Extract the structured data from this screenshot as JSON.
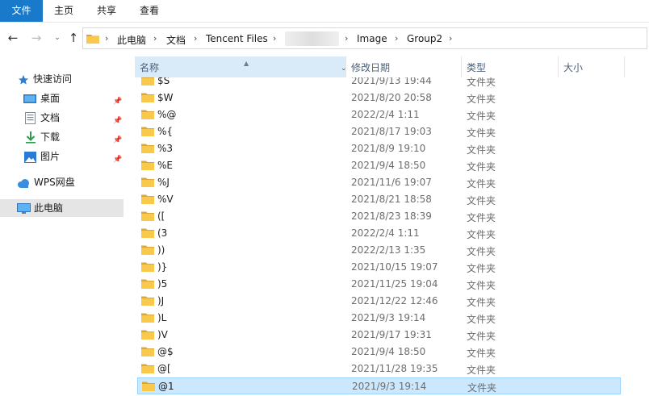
{
  "ribbon": {
    "file": "文件",
    "home": "主页",
    "share": "共享",
    "view": "查看"
  },
  "nav": {
    "back": "←",
    "forward": "→",
    "recent": "⌄",
    "up": "↑",
    "breadcrumb": [
      "此电脑",
      "文档",
      "Tencent Files",
      "Image",
      "Group2"
    ]
  },
  "sidebar": {
    "quick_access": "快速访问",
    "items": [
      {
        "label": "桌面",
        "icon": "desktop-icon"
      },
      {
        "label": "文档",
        "icon": "documents-icon"
      },
      {
        "label": "下载",
        "icon": "download-icon"
      },
      {
        "label": "图片",
        "icon": "pictures-icon"
      }
    ],
    "wps": "WPS网盘",
    "this_pc": "此电脑"
  },
  "columns": {
    "name": "名称",
    "date": "修改日期",
    "type": "类型",
    "size": "大小"
  },
  "files": [
    {
      "name": "$S",
      "date": "2021/9/13 19:44",
      "type": "文件夹"
    },
    {
      "name": "$W",
      "date": "2021/8/20 20:58",
      "type": "文件夹"
    },
    {
      "name": "%@",
      "date": "2022/2/4 1:11",
      "type": "文件夹"
    },
    {
      "name": "%{",
      "date": "2021/8/17 19:03",
      "type": "文件夹"
    },
    {
      "name": "%3",
      "date": "2021/8/9 19:10",
      "type": "文件夹"
    },
    {
      "name": "%E",
      "date": "2021/9/4 18:50",
      "type": "文件夹"
    },
    {
      "name": "%J",
      "date": "2021/11/6 19:07",
      "type": "文件夹"
    },
    {
      "name": "%V",
      "date": "2021/8/21 18:58",
      "type": "文件夹"
    },
    {
      "name": "([",
      "date": "2021/8/23 18:39",
      "type": "文件夹"
    },
    {
      "name": "(3",
      "date": "2022/2/4 1:11",
      "type": "文件夹"
    },
    {
      "name": "))",
      "date": "2022/2/13 1:35",
      "type": "文件夹"
    },
    {
      "name": ")}",
      "date": "2021/10/15 19:07",
      "type": "文件夹"
    },
    {
      "name": ")5",
      "date": "2021/11/25 19:04",
      "type": "文件夹"
    },
    {
      "name": ")J",
      "date": "2021/12/22 12:46",
      "type": "文件夹"
    },
    {
      "name": ")L",
      "date": "2021/9/3 19:14",
      "type": "文件夹"
    },
    {
      "name": ")V",
      "date": "2021/9/17 19:31",
      "type": "文件夹"
    },
    {
      "name": "@$",
      "date": "2021/9/4 18:50",
      "type": "文件夹"
    },
    {
      "name": "@[",
      "date": "2021/11/28 19:35",
      "type": "文件夹"
    },
    {
      "name": "@1",
      "date": "2021/9/3 19:14",
      "type": "文件夹",
      "selected": true
    }
  ],
  "colors": {
    "accent": "#1979ca",
    "selection": "#cce8ff",
    "folder": "#f8c94a"
  }
}
